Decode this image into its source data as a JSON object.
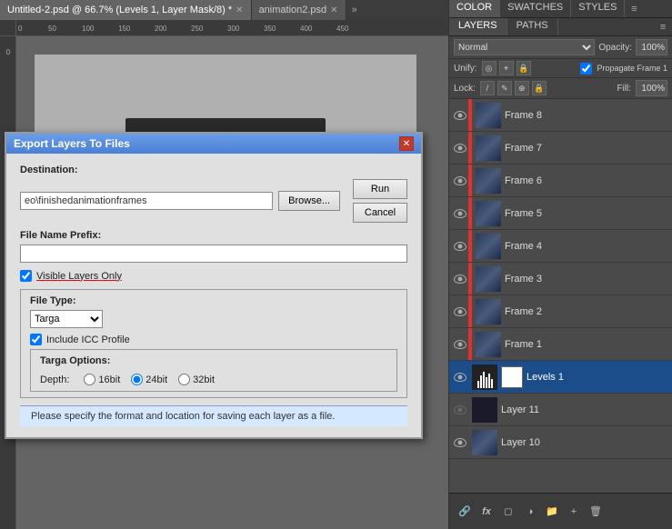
{
  "tabs": [
    {
      "label": "Untitled-2.psd @ 66.7% (Levels 1, Layer Mask/8) *",
      "active": true,
      "closable": true
    },
    {
      "label": "animation2.psd",
      "active": false,
      "closable": true
    }
  ],
  "dialog": {
    "title": "Export Layers To Files",
    "destination_label": "Destination:",
    "path_value": "eo\\finishedanimationframes",
    "browse_btn": "Browse...",
    "run_btn": "Run",
    "cancel_btn": "Cancel",
    "file_prefix_label": "File Name Prefix:",
    "file_prefix_value": "",
    "visible_layers_label": "Visible Layers Only",
    "filetype_label": "File Type:",
    "filetype_value": "Targa",
    "icc_label": "Include ICC Profile",
    "targa_options_label": "Targa Options:",
    "depth_label": "Depth:",
    "depth_16bit": "16bit",
    "depth_24bit": "24bit",
    "depth_32bit": "32bit",
    "depth_selected": "24bit",
    "status_text": "Please specify the format and location for saving each layer as a file."
  },
  "right_panel": {
    "top_tabs": [
      "COLOR",
      "SWATCHES",
      "STYLES"
    ],
    "active_top_tab": "COLOR",
    "panel_icon": "⊕",
    "layers_tabs": [
      "LAYERS",
      "PATHS"
    ],
    "active_layers_tab": "LAYERS",
    "blend_mode": "Normal",
    "opacity_label": "Opacity:",
    "opacity_value": "100%",
    "unify_label": "Unify:",
    "propagate_label": "Propagate Frame 1",
    "lock_label": "Lock:",
    "fill_label": "Fill:",
    "fill_value": "100%",
    "layers": [
      {
        "name": "Frame 8",
        "visible": true,
        "selected": false,
        "has_red_bar": true
      },
      {
        "name": "Frame 7",
        "visible": true,
        "selected": false,
        "has_red_bar": true
      },
      {
        "name": "Frame 6",
        "visible": true,
        "selected": false,
        "has_red_bar": true
      },
      {
        "name": "Frame 5",
        "visible": true,
        "selected": false,
        "has_red_bar": true
      },
      {
        "name": "Frame 4",
        "visible": true,
        "selected": false,
        "has_red_bar": true
      },
      {
        "name": "Frame 3",
        "visible": true,
        "selected": false,
        "has_red_bar": true
      },
      {
        "name": "Frame 2",
        "visible": true,
        "selected": false,
        "has_red_bar": true
      },
      {
        "name": "Frame 1",
        "visible": true,
        "selected": false,
        "has_red_bar": true
      },
      {
        "name": "Levels 1",
        "visible": true,
        "selected": true,
        "has_mask": true,
        "is_levels": true
      },
      {
        "name": "Layer 11",
        "visible": false,
        "selected": false
      },
      {
        "name": "Layer 10",
        "visible": true,
        "selected": false
      }
    ],
    "bottom_icons": [
      "🔗",
      "fx",
      "◻",
      "◧",
      "▼",
      "🗑"
    ]
  }
}
